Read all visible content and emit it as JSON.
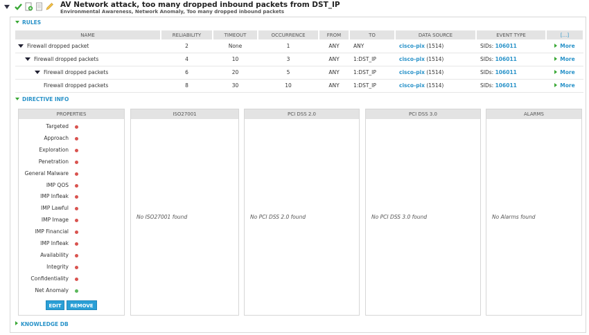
{
  "header": {
    "title": "AV Network attack, too many dropped inbound packets from DST_IP",
    "subtitle": "Environmental Awareness, Network Anomaly, Too many dropped inbound packets",
    "icons": [
      "check-icon",
      "add-document-icon",
      "document-icon",
      "pencil-icon"
    ]
  },
  "sections": {
    "rules": "RULES",
    "directive_info": "DIRECTIVE INFO",
    "knowledge_db": "KNOWLEDGE DB"
  },
  "rules": {
    "columns": [
      "NAME",
      "RELIABILITY",
      "TIMEOUT",
      "OCCURRENCE",
      "FROM",
      "TO",
      "DATA SOURCE",
      "EVENT TYPE",
      "[...]"
    ],
    "rows": [
      {
        "name": "Firewall dropped packet",
        "reliability": "2",
        "timeout": "None",
        "occurrence": "1",
        "from": "ANY",
        "to": "ANY",
        "ds_name": "cisco-pix",
        "ds_id": "(1514)",
        "sid_prefix": "SIDs: ",
        "sid": "106011",
        "more": "More"
      },
      {
        "name": "Firewall dropped packets",
        "reliability": "4",
        "timeout": "10",
        "occurrence": "3",
        "from": "ANY",
        "to": "1:DST_IP",
        "ds_name": "cisco-pix",
        "ds_id": "(1514)",
        "sid_prefix": "SIDs: ",
        "sid": "106011",
        "more": "More"
      },
      {
        "name": "Firewall dropped packets",
        "reliability": "6",
        "timeout": "20",
        "occurrence": "5",
        "from": "ANY",
        "to": "1:DST_IP",
        "ds_name": "cisco-pix",
        "ds_id": "(1514)",
        "sid_prefix": "SIDs: ",
        "sid": "106011",
        "more": "More"
      },
      {
        "name": "Firewall dropped packets",
        "reliability": "8",
        "timeout": "30",
        "occurrence": "10",
        "from": "ANY",
        "to": "1:DST_IP",
        "ds_name": "cisco-pix",
        "ds_id": "(1514)",
        "sid_prefix": "SIDs: ",
        "sid": "106011",
        "more": "More"
      }
    ]
  },
  "properties": {
    "title": "PROPERTIES",
    "items": [
      {
        "label": "Targeted",
        "status": "red"
      },
      {
        "label": "Approach",
        "status": "red"
      },
      {
        "label": "Exploration",
        "status": "red"
      },
      {
        "label": "Penetration",
        "status": "red"
      },
      {
        "label": "General Malware",
        "status": "red"
      },
      {
        "label": "IMP QOS",
        "status": "red"
      },
      {
        "label": "IMP Infleak",
        "status": "red"
      },
      {
        "label": "IMP Lawful",
        "status": "red"
      },
      {
        "label": "IMP Image",
        "status": "red"
      },
      {
        "label": "IMP Financial",
        "status": "red"
      },
      {
        "label": "IMP Infleak",
        "status": "red"
      },
      {
        "label": "Availability",
        "status": "red"
      },
      {
        "label": "Integrity",
        "status": "red"
      },
      {
        "label": "Confidentiality",
        "status": "red"
      },
      {
        "label": "Net Anomaly",
        "status": "green"
      }
    ],
    "edit": "EDIT",
    "remove": "REMOVE"
  },
  "panels": {
    "iso": {
      "title": "ISO27001",
      "empty": "No ISO27001 found"
    },
    "pci2": {
      "title": "PCI DSS 2.0",
      "empty": "No PCI DSS 2.0 found"
    },
    "pci3": {
      "title": "PCI DSS 3.0",
      "empty": "No PCI DSS 3.0 found"
    },
    "alarms": {
      "title": "ALARMS",
      "empty": "No Alarms found"
    }
  },
  "colors": {
    "accent": "#2a93c9",
    "green": "#3aa836",
    "red": "#d9534f",
    "ok": "#5cb85c"
  }
}
